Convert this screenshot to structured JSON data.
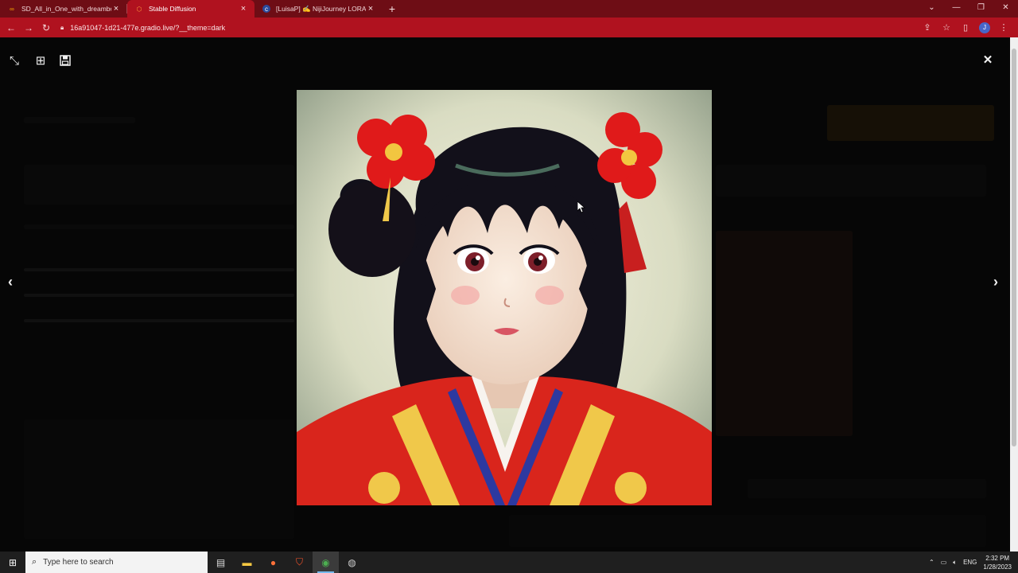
{
  "tabs": [
    {
      "title": "SD_All_in_One_with_dreambooth",
      "icon": "colab-icon",
      "active": false
    },
    {
      "title": "Stable Diffusion",
      "icon": "gradio-icon",
      "active": true
    },
    {
      "title": "[LuisaP] ✍️ NijiJourney LORA | St",
      "icon": "civitai-icon",
      "active": false
    }
  ],
  "address": {
    "url": "16a91047-1d21-477e.gradio.live/?__theme=dark"
  },
  "lightbox": {
    "close": "✕",
    "prev": "‹",
    "next": "›"
  },
  "taskbar": {
    "search_placeholder": "Type here to search",
    "language": "ENG",
    "time": "2:32 PM",
    "date": "1/28/2023"
  },
  "colors": {
    "tab_strip": "#6e0d15",
    "toolbar": "#b0121f",
    "kimono_red": "#d9251c",
    "hair": "#12101a"
  }
}
